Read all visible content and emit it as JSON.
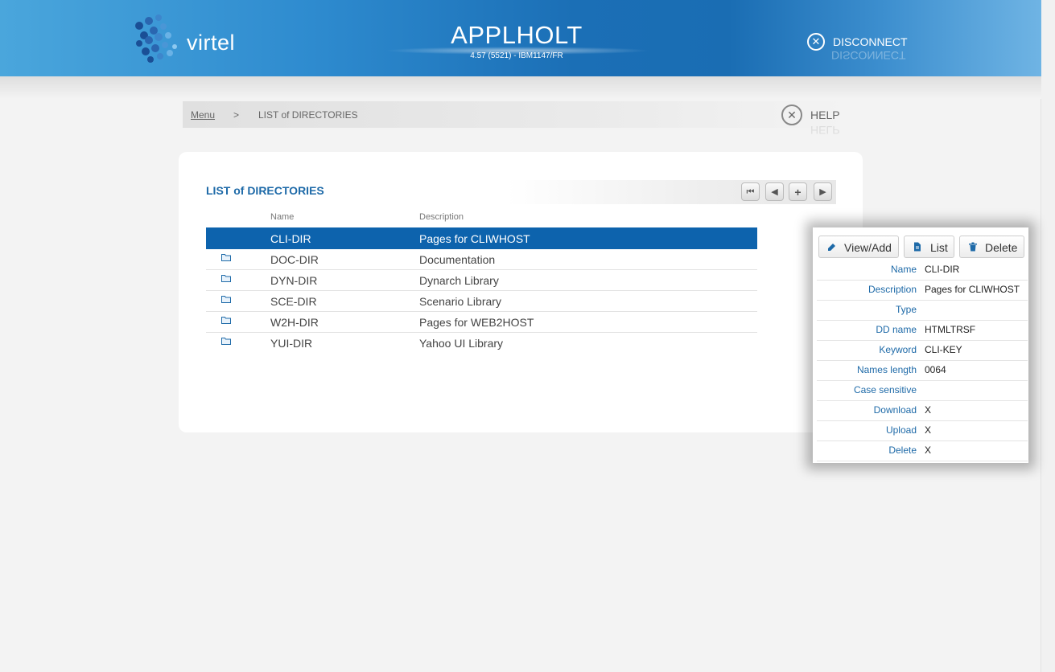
{
  "header": {
    "logo_text": "virtel",
    "app_title": "APPLHOLT",
    "app_subtitle": "4.57 (5521) - IBM1147/FR",
    "disconnect_label": "DISCONNECT"
  },
  "breadcrumb": {
    "menu_label": "Menu",
    "separator": ">",
    "current": "LIST of DIRECTORIES",
    "help_label": "HELP"
  },
  "list": {
    "title": "LIST of DIRECTORIES",
    "columns": {
      "name": "Name",
      "description": "Description"
    },
    "rows": [
      {
        "name": "CLI-DIR",
        "description": "Pages for CLIWHOST",
        "selected": true
      },
      {
        "name": "DOC-DIR",
        "description": "Documentation",
        "selected": false
      },
      {
        "name": "DYN-DIR",
        "description": "Dynarch Library",
        "selected": false
      },
      {
        "name": "SCE-DIR",
        "description": "Scenario Library",
        "selected": false
      },
      {
        "name": "W2H-DIR",
        "description": "Pages for WEB2HOST",
        "selected": false
      },
      {
        "name": "YUI-DIR",
        "description": "Yahoo UI Library",
        "selected": false
      }
    ],
    "nav_icons": [
      "first-page-icon",
      "prev-page-icon",
      "add-icon",
      "next-page-icon"
    ]
  },
  "detail": {
    "buttons": {
      "view_add": "View/Add",
      "list": "List",
      "delete": "Delete"
    },
    "fields": [
      {
        "label": "Name",
        "value": "CLI-DIR"
      },
      {
        "label": "Description",
        "value": "Pages for CLIWHOST"
      },
      {
        "label": "Type",
        "value": ""
      },
      {
        "label": "DD name",
        "value": "HTMLTRSF"
      },
      {
        "label": "Keyword",
        "value": "CLI-KEY"
      },
      {
        "label": "Names length",
        "value": "0064"
      },
      {
        "label": "Case sensitive",
        "value": ""
      },
      {
        "label": "Download",
        "value": "X"
      },
      {
        "label": "Upload",
        "value": "X"
      },
      {
        "label": "Delete",
        "value": "X"
      }
    ]
  },
  "colors": {
    "accent": "#1e6aa8",
    "selected_row": "#0d63ad",
    "header_blue": "#1b6fb6"
  }
}
